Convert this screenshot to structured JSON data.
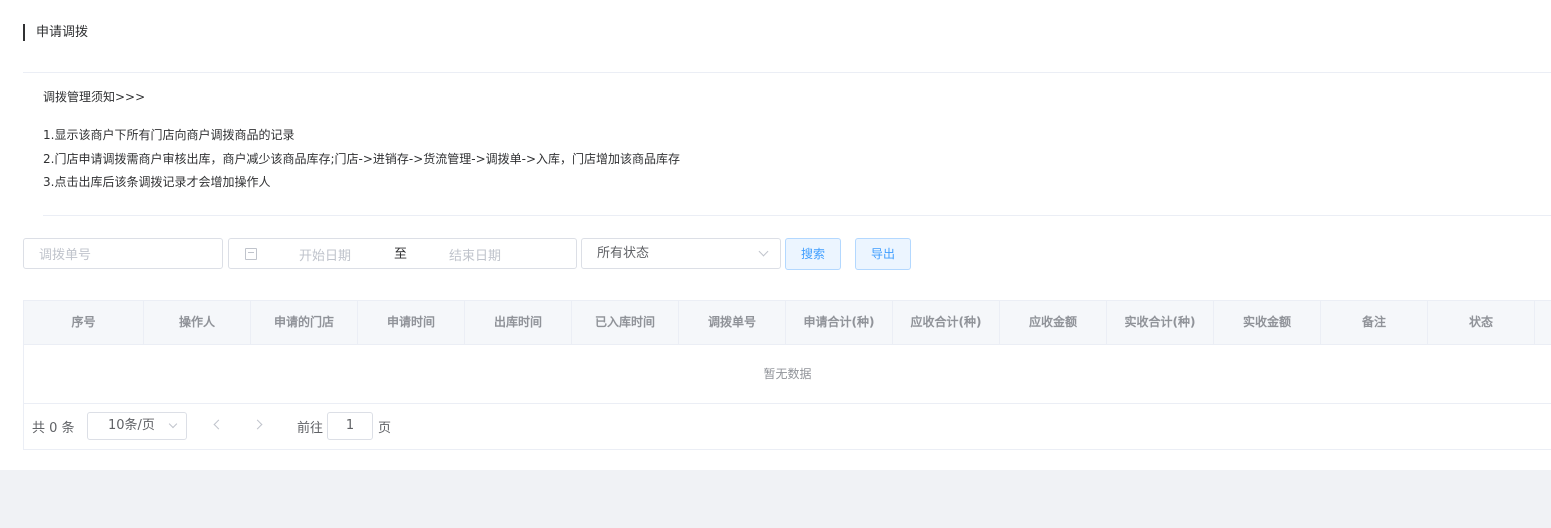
{
  "page_title": "申请调拨",
  "notice": {
    "title": "调拨管理须知>>>",
    "items": [
      "1.显示该商户下所有门店向商户调拨商品的记录",
      "2.门店申请调拨需商户审核出库，商户减少该商品库存;门店->进销存->货流管理->调拨单->入库，门店增加该商品库存",
      "3.点击出库后该条调拨记录才会增加操作人"
    ]
  },
  "filters": {
    "order_no_placeholder": "调拨单号",
    "start_date_placeholder": "开始日期",
    "range_separator": "至",
    "end_date_placeholder": "结束日期",
    "status_value": "所有状态",
    "search_label": "搜索",
    "export_label": "导出"
  },
  "table": {
    "columns": [
      "序号",
      "操作人",
      "申请的门店",
      "申请时间",
      "出库时间",
      "已入库时间",
      "调拨单号",
      "申请合计(种)",
      "应收合计(种)",
      "应收金额",
      "实收合计(种)",
      "实收金额",
      "备注",
      "状态"
    ],
    "empty_text": "暂无数据"
  },
  "pagination": {
    "total_text": "共 0 条",
    "page_size": "10条/页",
    "goto_label": "前往",
    "current_page": "1",
    "page_suffix": "页"
  }
}
